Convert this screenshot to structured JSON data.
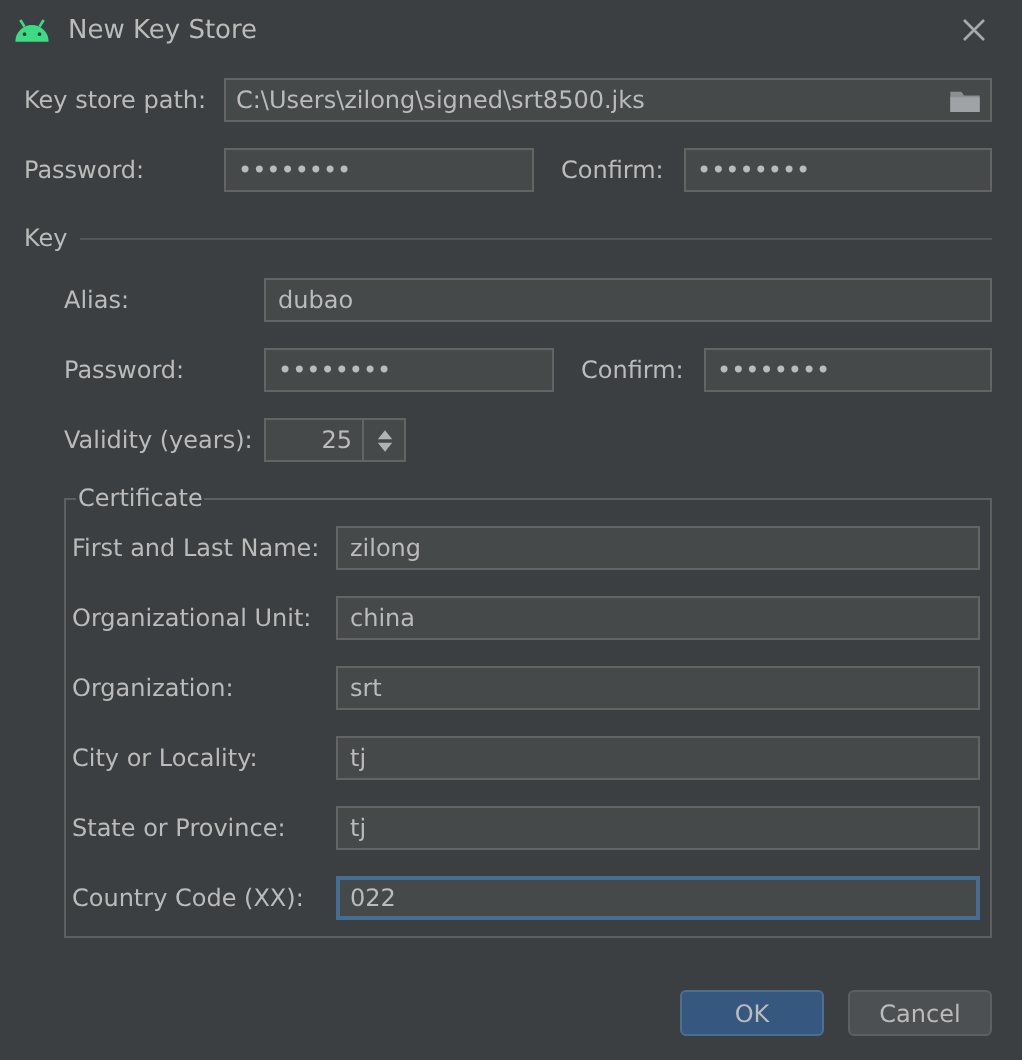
{
  "window": {
    "title": "New Key Store"
  },
  "key_store": {
    "path_label": "Key store path:",
    "path": "C:\\Users\\zilong\\signed\\srt8500.jks",
    "password_label": "Password:",
    "password": "••••••••",
    "confirm_label": "Confirm:",
    "confirm": "••••••••"
  },
  "key": {
    "title": "Key",
    "alias_label": "Alias:",
    "alias": "dubao",
    "password_label": "Password:",
    "password": "••••••••",
    "confirm_label": "Confirm:",
    "confirm": "••••••••",
    "validity_label": "Validity (years):",
    "validity": "25"
  },
  "certificate": {
    "title": "Certificate",
    "fields": [
      {
        "label": "First and Last Name:",
        "value": "zilong",
        "focused": false
      },
      {
        "label": "Organizational Unit:",
        "value": "china",
        "focused": false
      },
      {
        "label": "Organization:",
        "value": "srt",
        "focused": false
      },
      {
        "label": "City or Locality:",
        "value": "tj",
        "focused": false
      },
      {
        "label": "State or Province:",
        "value": "tj",
        "focused": false
      },
      {
        "label": "Country Code (XX):",
        "value": "022",
        "focused": true
      }
    ]
  },
  "buttons": [
    {
      "label": "OK",
      "kind": "primary"
    },
    {
      "label": "Cancel",
      "kind": "secondary"
    }
  ]
}
